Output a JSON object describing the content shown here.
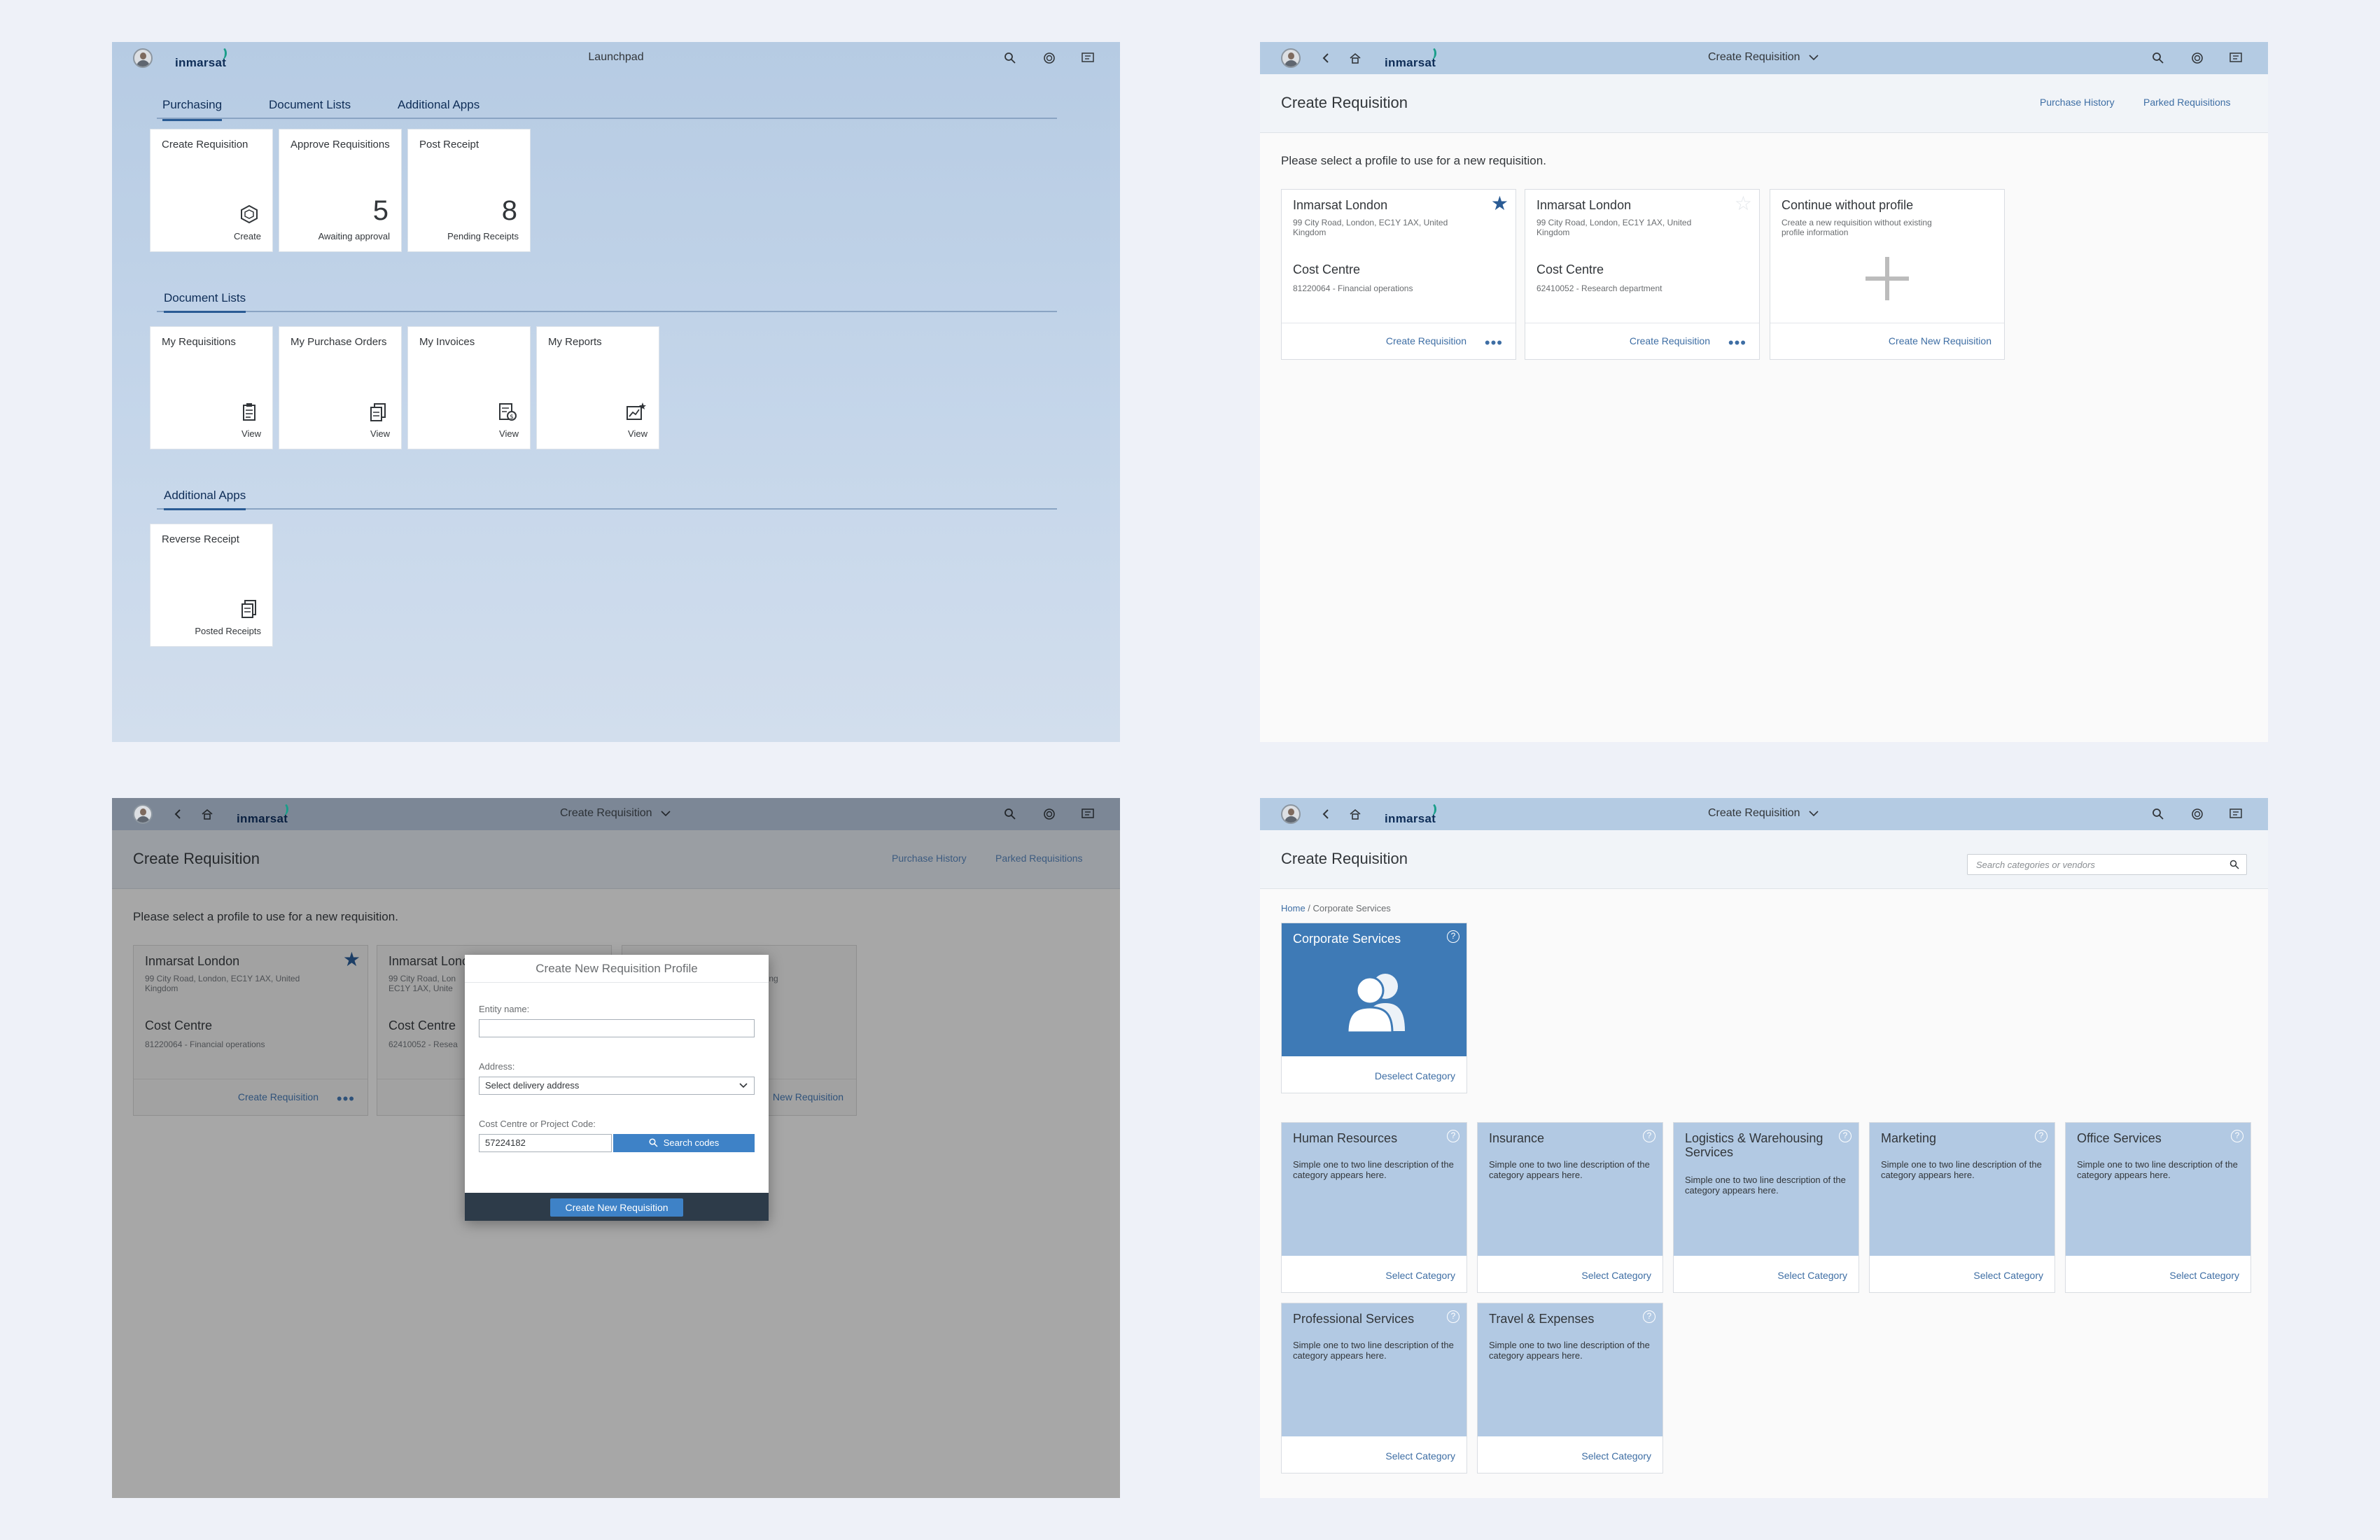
{
  "brand": {
    "logo_text": "inmarsat"
  },
  "launchpad": {
    "title": "Launchpad",
    "tabs": [
      {
        "label": "Purchasing"
      },
      {
        "label": "Document Lists"
      },
      {
        "label": "Additional Apps"
      }
    ],
    "tiles_purchasing": [
      {
        "title": "Create Requisition",
        "sub": "Create",
        "icon": "hexagon-icon"
      },
      {
        "title": "Approve Requisitions",
        "number": "5",
        "sub": "Awaiting approval"
      },
      {
        "title": "Post Receipt",
        "number": "8",
        "sub": "Pending Receipts"
      }
    ],
    "group_documents": "Document Lists",
    "tiles_documents": [
      {
        "title": "My Requisitions",
        "sub": "View",
        "icon": "clipboard-icon"
      },
      {
        "title": "My Purchase Orders",
        "sub": "View",
        "icon": "documents-icon"
      },
      {
        "title": "My Invoices",
        "sub": "View",
        "icon": "invoice-icon"
      },
      {
        "title": "My Reports",
        "sub": "View",
        "icon": "report-chart-icon"
      }
    ],
    "group_apps": "Additional Apps",
    "tiles_apps": [
      {
        "title": "Reverse Receipt",
        "sub": "Posted Receipts",
        "icon": "receipt-icon"
      }
    ]
  },
  "create_req": {
    "shell_title": "Create Requisition",
    "page_title": "Create Requisition",
    "links": {
      "history": "Purchase History",
      "parked": "Parked Requisitions"
    },
    "prompt": "Please select a profile to use for a new requisition.",
    "profiles": [
      {
        "name": "Inmarsat London",
        "address": "99 City Road, London, EC1Y 1AX, United Kingdom",
        "cc_label": "Cost Centre",
        "cc": "81220064 - Financial operations",
        "action": "Create Requisition",
        "favorite": true
      },
      {
        "name": "Inmarsat London",
        "address": "99 City Road, London, EC1Y 1AX, United Kingdom",
        "cc_label": "Cost Centre",
        "cc": "62410052 - Research department",
        "action": "Create Requisition",
        "favorite": false
      }
    ],
    "new_profile": {
      "name": "Continue without profile",
      "desc": "Create a new requisition without existing profile information",
      "action": "Create New Requisition"
    }
  },
  "dialog_screen": {
    "card2_name": "Inmarsat Lonc",
    "card2_address": "99 City Road, Lon EC1Y 1AX, Unite",
    "card2_cc": "62410052 - Resea",
    "card3_desc": "existing",
    "card3_action": "New Requisition"
  },
  "dialog": {
    "title": "Create New Requisition Profile",
    "entity_label": "Entity name:",
    "entity_value": "",
    "address_label": "Address:",
    "address_value": "Select delivery address",
    "code_label": "Cost Centre or Project Code:",
    "code_value": "57224182",
    "search_btn": "Search codes",
    "create_btn": "Create New Requisition"
  },
  "catalog": {
    "shell_title": "Create Requisition",
    "page_title": "Create Requisition",
    "search_placeholder": "Search categories or vendors",
    "breadcrumb_home": "Home",
    "breadcrumb_sep": " / ",
    "breadcrumb_current": "Corporate Services",
    "selected": {
      "name": "Corporate Services",
      "action": "Deselect Category"
    },
    "categories": [
      {
        "name": "Human Resources",
        "desc": "Simple one to two line description of the category appears here.",
        "action": "Select Category"
      },
      {
        "name": "Insurance",
        "desc": "Simple one to two line description of the category appears here.",
        "action": "Select Category"
      },
      {
        "name": "Logistics & Warehousing Services",
        "desc": "Simple one to two line description of the category appears here.",
        "action": "Select Category"
      },
      {
        "name": "Marketing",
        "desc": "Simple one to two line description of the category appears here.",
        "action": "Select Category"
      },
      {
        "name": "Office Services",
        "desc": "Simple one to two line description of the category appears here.",
        "action": "Select Category"
      },
      {
        "name": "Professional Services",
        "desc": "Simple one to two line description of the category appears here.",
        "action": "Select Category"
      },
      {
        "name": "Travel & Expenses",
        "desc": "Simple one to two line description of the category appears here.",
        "action": "Select Category"
      }
    ]
  },
  "colors": {
    "accent": "#2a5b94",
    "link": "#3e6ea4",
    "tile_bg": "#b2c9e3",
    "selected": "#3e7ab6"
  }
}
